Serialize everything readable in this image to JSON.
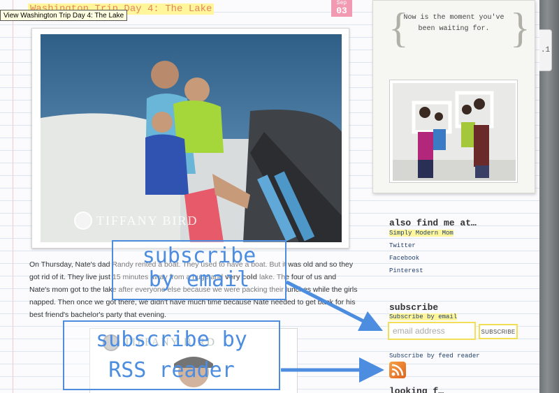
{
  "tooltip": "View Washington Trip Day 4: The Lake",
  "post": {
    "title": "Washington Trip Day 4: The Lake",
    "date_month": "Sep",
    "date_day": "03",
    "watermark": "TIFFANY BIRD",
    "body_1": "On Thursday, Nate's dad Randy rented a boat. They used to have a boat. But it was old and so they got rid of it. They live just 15 minutes away from a huge and",
    "body_bold": "very cold",
    "body_2": "lake. The four of us and Nate's mom got to the lake after everyone else because we were packing their lunches while the girls napped. Then once we got there, we didn't have much time because Nate needed to get back for his best friend's bachelor's party that evening.",
    "watermark_2": "TIFFANY BIRD"
  },
  "callouts": {
    "email_line1": "subscribe",
    "email_line2": "by email",
    "rss_line1": "subscribe by",
    "rss_line2": "RSS reader"
  },
  "sidebar": {
    "quote": "Now is the moment you've been waiting for.",
    "also_heading": "also find me at…",
    "links": [
      "Simply Modern Mom",
      "Twitter",
      "Facebook",
      "Pinterest"
    ],
    "subscribe_heading": "subscribe",
    "subscribe_email_label": "Subscribe by email",
    "email_placeholder": "email address",
    "subscribe_button": "SUBSCRIBE",
    "feed_label": "Subscribe by feed reader",
    "bottom_heading": "looking f…"
  },
  "side_tab": ".1",
  "colors": {
    "title_text": "#e2865d",
    "highlight": "#fff59a",
    "date_badge": "#f29ab2",
    "callout": "#4d8de0",
    "link": "#1f3f6e",
    "input_border": "#f2df55"
  }
}
